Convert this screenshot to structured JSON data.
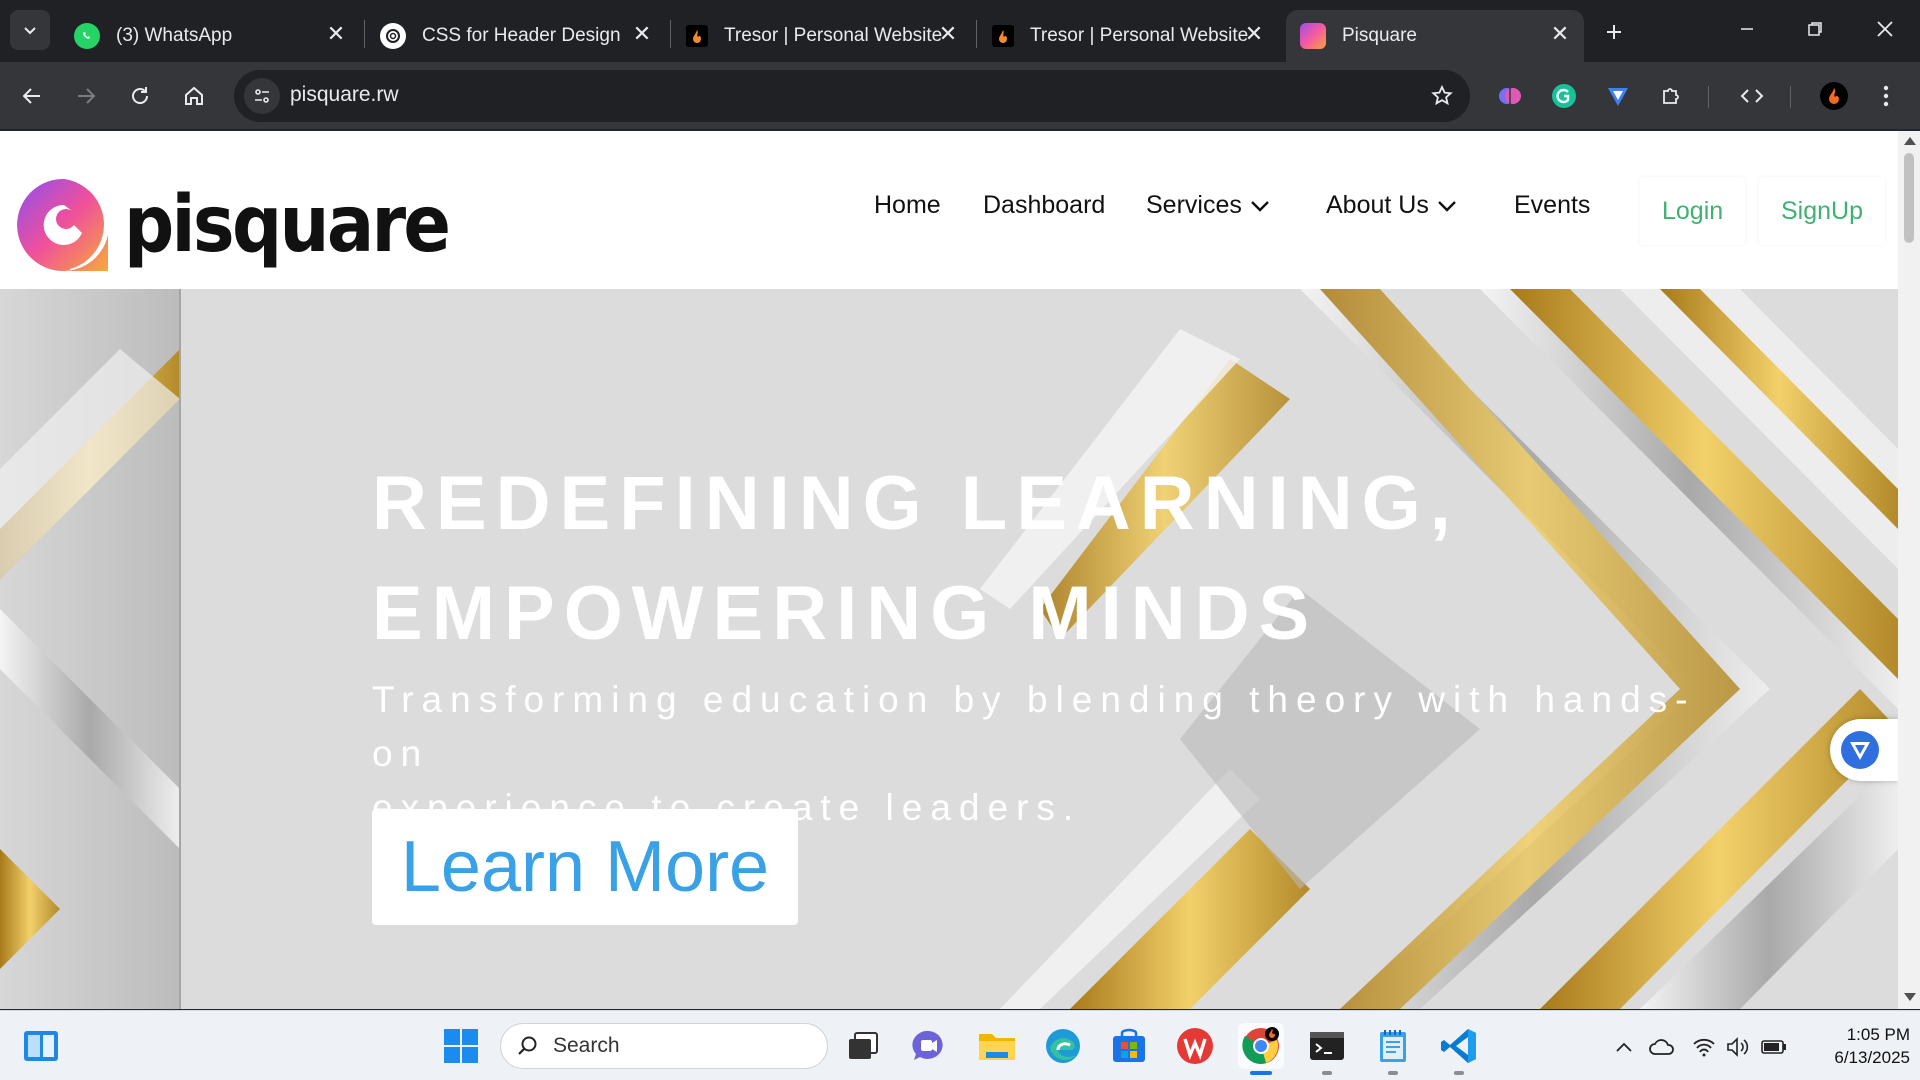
{
  "browser": {
    "tabs": [
      {
        "title": "(3) WhatsApp",
        "icon": "whatsapp-icon",
        "active": false
      },
      {
        "title": "CSS for Header Design",
        "icon": "chatgpt-icon",
        "active": false
      },
      {
        "title": "Tresor | Personal Website",
        "icon": "tresor-icon",
        "active": false
      },
      {
        "title": "Tresor | Personal Website",
        "icon": "tresor-icon",
        "active": false
      },
      {
        "title": "Pisquare",
        "icon": "pisquare-icon",
        "active": true
      }
    ],
    "url": "pisquare.rw"
  },
  "site": {
    "logo_text": "pisquare",
    "nav": {
      "home": "Home",
      "dashboard": "Dashboard",
      "services": "Services",
      "about": "About Us",
      "events": "Events",
      "login": "Login",
      "signup": "SignUp"
    },
    "hero": {
      "title_line1": "REDEFINING LEARNING,",
      "title_line2": "EMPOWERING MINDS",
      "subtitle_line1": "Transforming education by blending theory with hands-on",
      "subtitle_line2": "experience to create leaders.",
      "cta": "Learn More"
    }
  },
  "taskbar": {
    "search_placeholder": "Search",
    "time": "1:05 PM",
    "date": "6/13/2025"
  },
  "colors": {
    "accent_green": "#3cb371",
    "cta_blue": "#3aa1e6",
    "chrome_dark": "#202124",
    "chrome_toolbar": "#35363a"
  }
}
